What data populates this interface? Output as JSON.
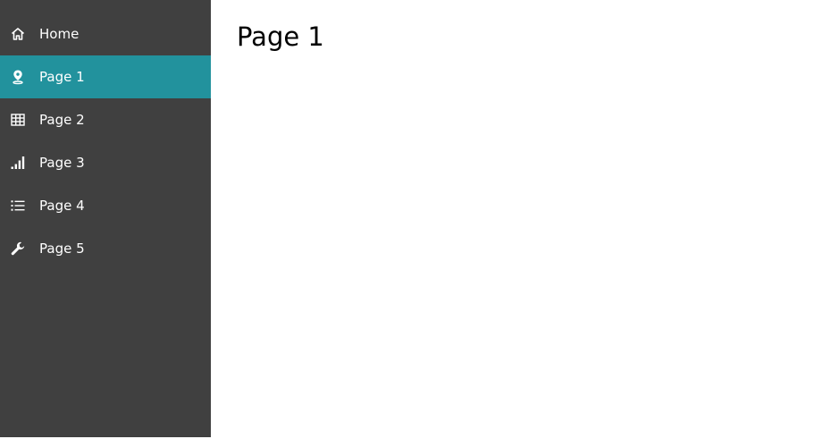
{
  "colors": {
    "sidebar_bg": "#404040",
    "active_bg": "#22929d",
    "content_bg": "#ffffff",
    "text_light": "#ffffff",
    "text_dark": "#000000"
  },
  "sidebar": {
    "items": [
      {
        "label": "Home",
        "icon": "home-icon",
        "active": false
      },
      {
        "label": "Page 1",
        "icon": "map-pin-icon",
        "active": true
      },
      {
        "label": "Page 2",
        "icon": "table-grid-icon",
        "active": false
      },
      {
        "label": "Page 3",
        "icon": "signal-bars-icon",
        "active": false
      },
      {
        "label": "Page 4",
        "icon": "list-icon",
        "active": false
      },
      {
        "label": "Page 5",
        "icon": "wrench-icon",
        "active": false
      }
    ]
  },
  "main": {
    "title": "Page 1"
  }
}
